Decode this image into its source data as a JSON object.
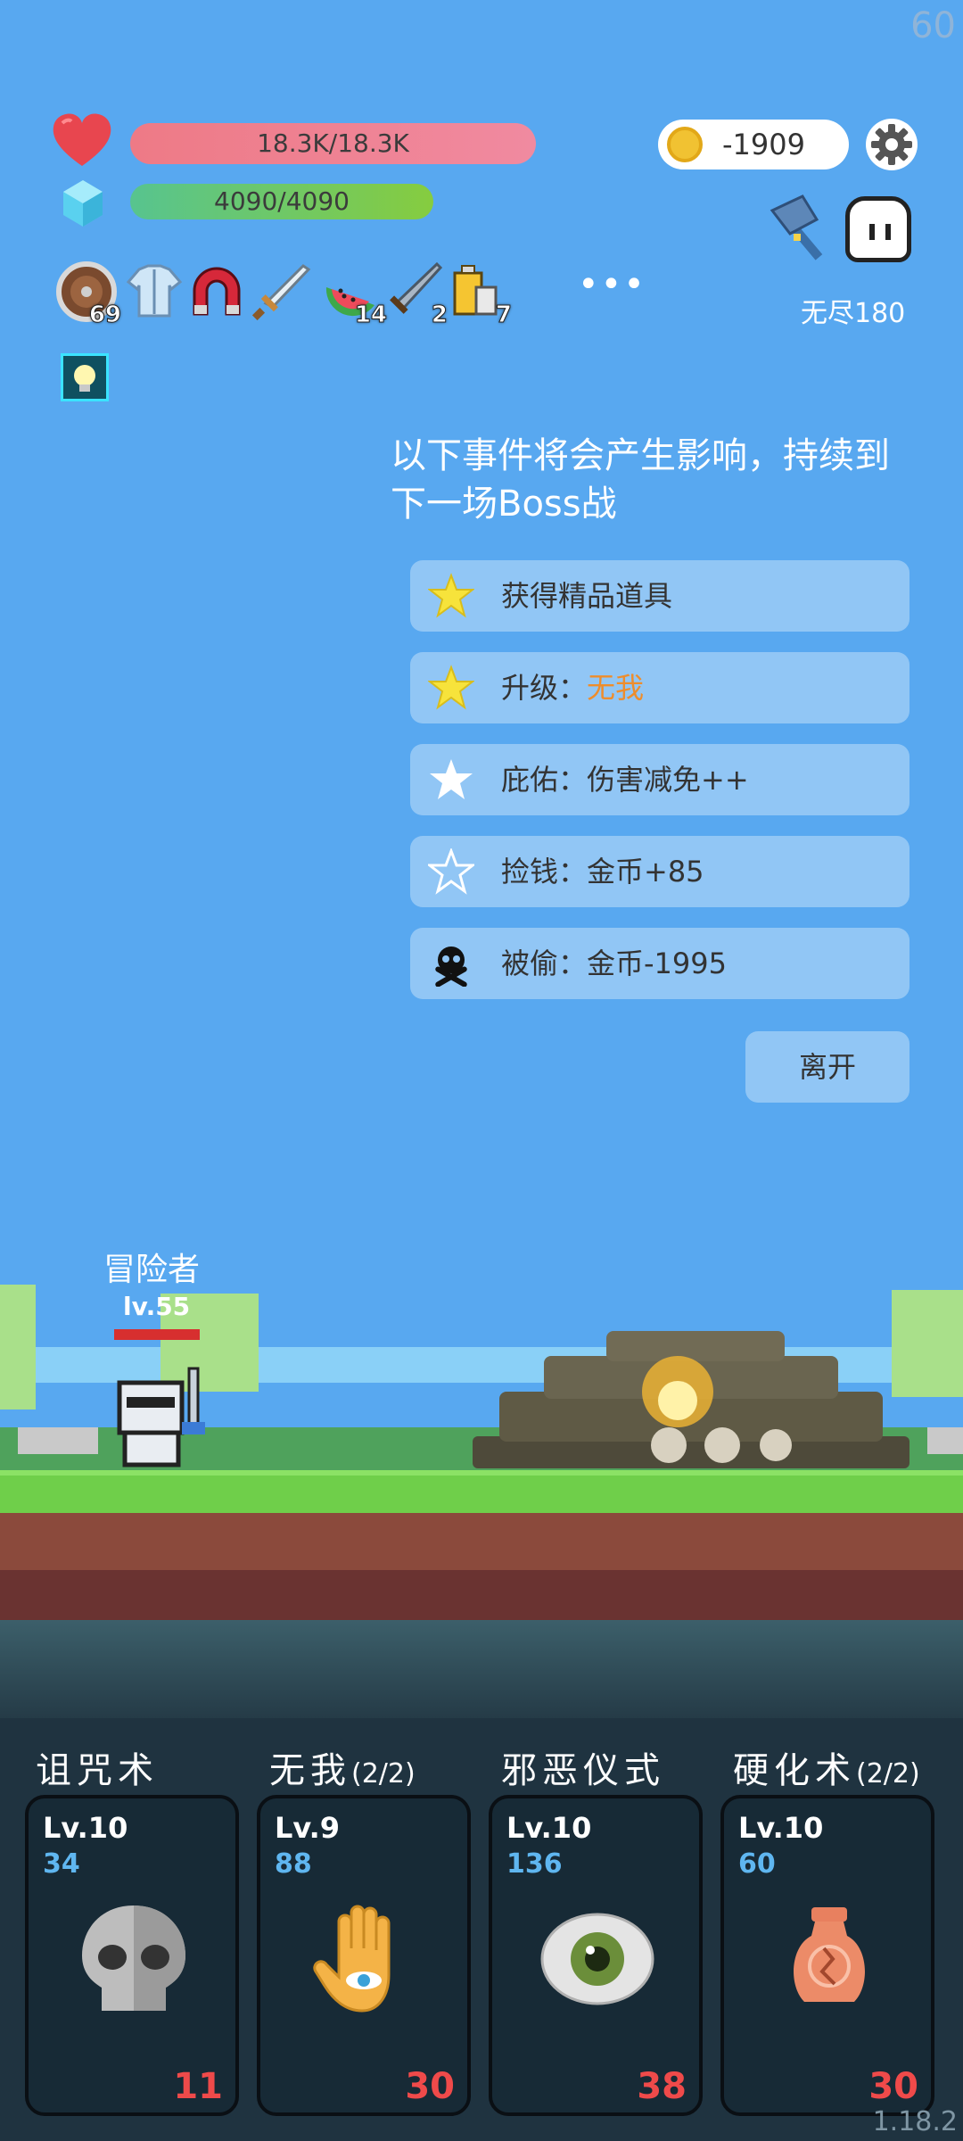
{
  "fps": "60",
  "stats": {
    "hp": "18.3K/18.3K",
    "mp": "4090/4090"
  },
  "currency": {
    "gold": "-1909"
  },
  "mode": {
    "label": "无尽180"
  },
  "items": [
    {
      "icon": "shield-icon",
      "count": "69"
    },
    {
      "icon": "shirt-icon",
      "count": ""
    },
    {
      "icon": "magnet-icon",
      "count": ""
    },
    {
      "icon": "sword-icon",
      "count": ""
    },
    {
      "icon": "watermelon-icon",
      "count": "14"
    },
    {
      "icon": "blade-icon",
      "count": "2"
    },
    {
      "icon": "battery-icon",
      "count": "7"
    }
  ],
  "more_label": "•••",
  "event_panel": {
    "heading": "以下事件将会产生影响，持续到下一场Boss战",
    "events": [
      {
        "icon": "star-filled-icon",
        "prefix": "获得精品道具",
        "highlight": ""
      },
      {
        "icon": "star-filled-icon",
        "prefix": "升级：",
        "highlight": "无我"
      },
      {
        "icon": "star-white-icon",
        "prefix": "庇佑：伤害减免++",
        "highlight": ""
      },
      {
        "icon": "star-outline-icon",
        "prefix": "捡钱：金币+85",
        "highlight": ""
      },
      {
        "icon": "skull-crossbones-icon",
        "prefix": "被偷：金币-1995",
        "highlight": ""
      }
    ],
    "leave_label": "离开"
  },
  "hero": {
    "name": "冒险者",
    "level": "lv.55",
    "hp_fraction": 1.0
  },
  "skills": [
    {
      "title": "诅咒术",
      "suffix": "",
      "level": "Lv.10",
      "value": "34",
      "cost": "11",
      "icon": "skull-icon"
    },
    {
      "title": "无我",
      "suffix": "(2/2)",
      "level": "Lv.9",
      "value": "88",
      "cost": "30",
      "icon": "hand-eye-icon"
    },
    {
      "title": "邪恶仪式",
      "suffix": "",
      "level": "Lv.10",
      "value": "136",
      "cost": "38",
      "icon": "eye-icon"
    },
    {
      "title": "硬化术",
      "suffix": "(2/2)",
      "level": "Lv.10",
      "value": "60",
      "cost": "30",
      "icon": "vase-icon"
    }
  ],
  "version": "1.18.2",
  "colors": {
    "sky": "#58a8f0",
    "event_bg": "#91c6f5",
    "highlight": "#ee8d2c",
    "cost": "#ef4a4a",
    "skill_value": "#5fb6f0"
  }
}
